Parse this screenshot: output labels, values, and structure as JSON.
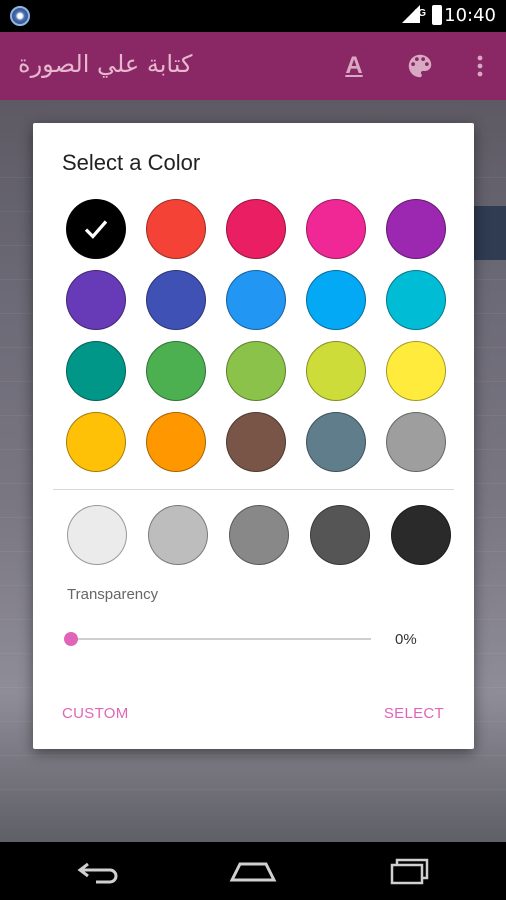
{
  "status_bar": {
    "time": "10:40",
    "network": "4G",
    "app_icon": "satellite-app-icon"
  },
  "toolbar": {
    "title": "كتابة علي الصورة",
    "icons": [
      "text-format-icon",
      "palette-icon",
      "overflow-menu-icon"
    ]
  },
  "dialog": {
    "title": "Select a Color",
    "selected_index": 0,
    "palette": [
      "#000000",
      "#F44336",
      "#E91E63",
      "#F02896",
      "#9C27B0",
      "#673AB7",
      "#3F51B5",
      "#2196F3",
      "#03A9F4",
      "#00BCD4",
      "#009688",
      "#4CAF50",
      "#8BC34A",
      "#CDDC39",
      "#FFEB3B",
      "#FFC107",
      "#FF9800",
      "#795548",
      "#607D8B",
      "#9E9E9E"
    ],
    "grays": [
      "#EBEBEB",
      "#BDBDBD",
      "#888888",
      "#555555",
      "#2A2A2A"
    ],
    "transparency": {
      "label": "Transparency",
      "value_text": "0%",
      "value": 0
    },
    "buttons": {
      "custom": "CUSTOM",
      "select": "SELECT"
    },
    "accent_color": "#E065B8"
  },
  "nav_bar": {
    "icons": [
      "back-icon",
      "home-icon",
      "recent-apps-icon"
    ]
  }
}
